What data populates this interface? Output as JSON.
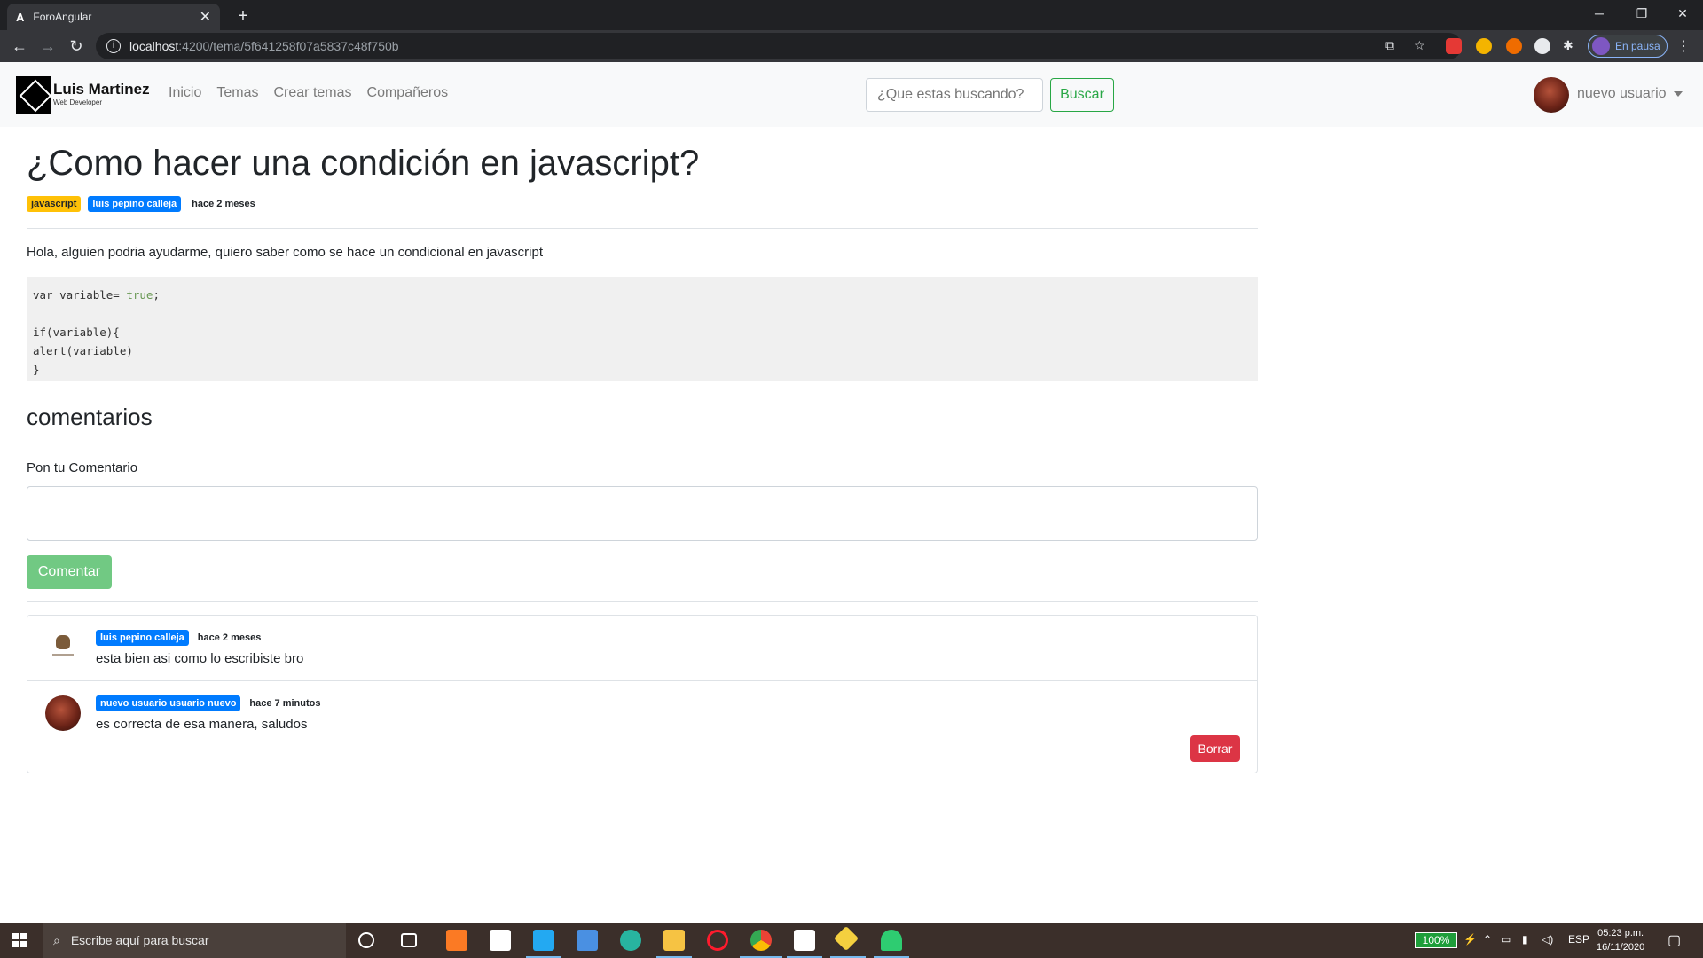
{
  "browser": {
    "tab_title": "ForoAngular",
    "tab_favicon": "A",
    "url_host": "localhost",
    "url_path": ":4200/tema/5f641258f07a5837c48f750b",
    "profile_status": "En pausa"
  },
  "navbar": {
    "brand_name": "Luis Martinez",
    "brand_sub": "Web Developer",
    "links": [
      "Inicio",
      "Temas",
      "Crear temas",
      "Compañeros"
    ],
    "search_placeholder": "¿Que estas buscando?",
    "search_button": "Buscar",
    "user_name": "nuevo usuario"
  },
  "topic": {
    "title": "¿Como hacer una condición en javascript?",
    "language_badge": "javascript",
    "author_badge": "luis pepino calleja",
    "time": "hace 2 meses",
    "content": "Hola, alguien podria ayudarme, quiero saber como se hace un condicional en javascript",
    "code_line1_pre": "var variable= ",
    "code_line1_value": "true",
    "code_line1_post": ";",
    "code_rest": "if(variable){\nalert(variable)\n}"
  },
  "comments_section": {
    "title": "comentarios",
    "input_label": "Pon tu Comentario",
    "submit_button": "Comentar",
    "items": [
      {
        "author": "luis pepino calleja",
        "time": "hace 2 meses",
        "text": "esta bien asi como lo escribiste bro"
      },
      {
        "author": "nuevo usuario usuario nuevo",
        "time": "hace 7 minutos",
        "text": "es correcta de esa manera, saludos",
        "delete_button": "Borrar"
      }
    ]
  },
  "taskbar": {
    "search_placeholder": "Escribe aquí para buscar",
    "battery": "100%",
    "language": "ESP",
    "time": "05:23 p.m.",
    "date": "16/11/2020"
  },
  "colors": {
    "badge_yellow": "#ffc107",
    "badge_blue": "#007bff",
    "success": "#28a745",
    "danger": "#dc3545"
  }
}
